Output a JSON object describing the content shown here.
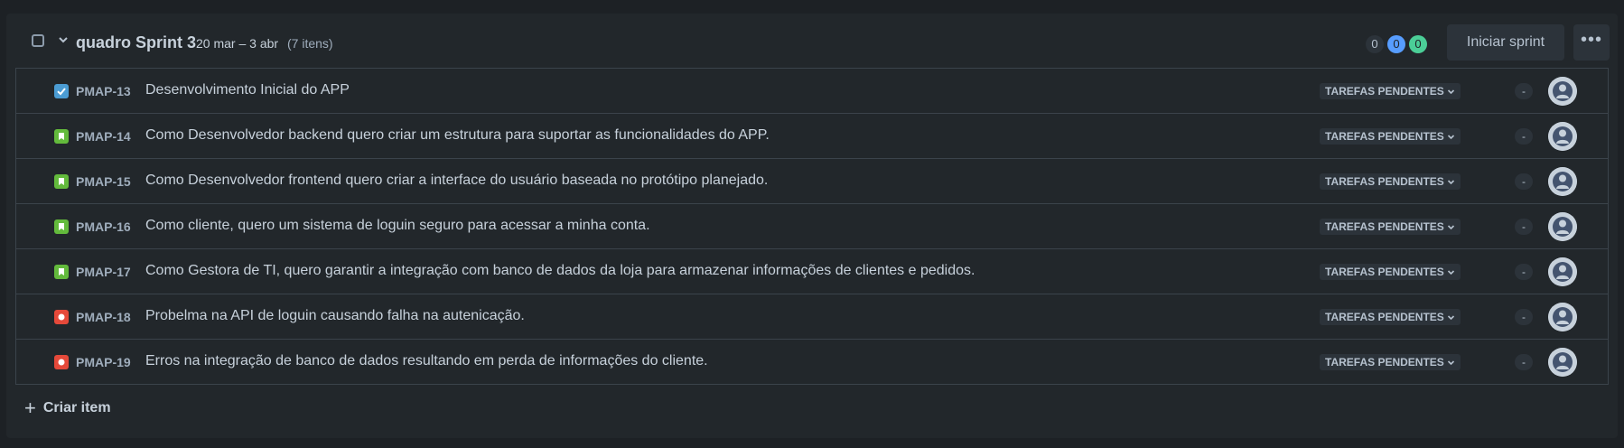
{
  "sprint": {
    "name": "quadro Sprint 3",
    "dates": "20 mar – 3 abr",
    "item_count": "(7 itens)",
    "counts": {
      "todo": "0",
      "in_progress": "0",
      "done": "0"
    },
    "start_label": "Iniciar sprint",
    "more_label": "•••"
  },
  "issues": [
    {
      "key": "PMAP-13",
      "type": "task",
      "summary": "Desenvolvimento Inicial do APP",
      "status": "TAREFAS PENDENTES",
      "estimate": "-"
    },
    {
      "key": "PMAP-14",
      "type": "story",
      "summary": "Como Desenvolvedor backend quero criar um estrutura para suportar as funcionalidades do APP.",
      "status": "TAREFAS PENDENTES",
      "estimate": "-"
    },
    {
      "key": "PMAP-15",
      "type": "story",
      "summary": "Como Desenvolvedor frontend quero criar a interface do usuário baseada no protótipo planejado.",
      "status": "TAREFAS PENDENTES",
      "estimate": "-"
    },
    {
      "key": "PMAP-16",
      "type": "story",
      "summary": "Como cliente, quero um sistema de loguin seguro para acessar a minha conta.",
      "status": "TAREFAS PENDENTES",
      "estimate": "-"
    },
    {
      "key": "PMAP-17",
      "type": "story",
      "summary": "Como Gestora de TI, quero garantir a integração com banco de dados da loja para armazenar informações de clientes e pedidos.",
      "status": "TAREFAS PENDENTES",
      "estimate": "-"
    },
    {
      "key": "PMAP-18",
      "type": "bug",
      "summary": "Probelma na API de loguin causando falha na autenicação.",
      "status": "TAREFAS PENDENTES",
      "estimate": "-"
    },
    {
      "key": "PMAP-19",
      "type": "bug",
      "summary": "Erros na integração de banco de dados resultando em perda de informações do cliente.",
      "status": "TAREFAS PENDENTES",
      "estimate": "-"
    }
  ],
  "create_item_label": "Criar item",
  "colors": {
    "task": "#4b9cd3",
    "story": "#63ba3c",
    "bug": "#e5493a",
    "in_progress": "#579dff",
    "done": "#4bce97"
  }
}
